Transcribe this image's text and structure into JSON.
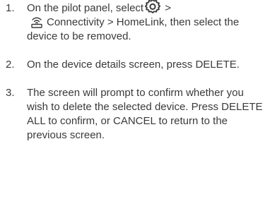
{
  "steps": [
    {
      "number": "1.",
      "segments": {
        "a": "On the pilot panel, select",
        "b": " >",
        "c": "Connectivity > HomeLink, then select the device to be removed."
      },
      "icons": [
        "gear-icon",
        "homelink-icon"
      ]
    },
    {
      "number": "2.",
      "text": "On the device details screen, press DELETE."
    },
    {
      "number": "3.",
      "text": "The screen will prompt to confirm whether you wish to delete the selected device. Press DELETE ALL to confirm, or CANCEL to return to the previous screen."
    }
  ]
}
